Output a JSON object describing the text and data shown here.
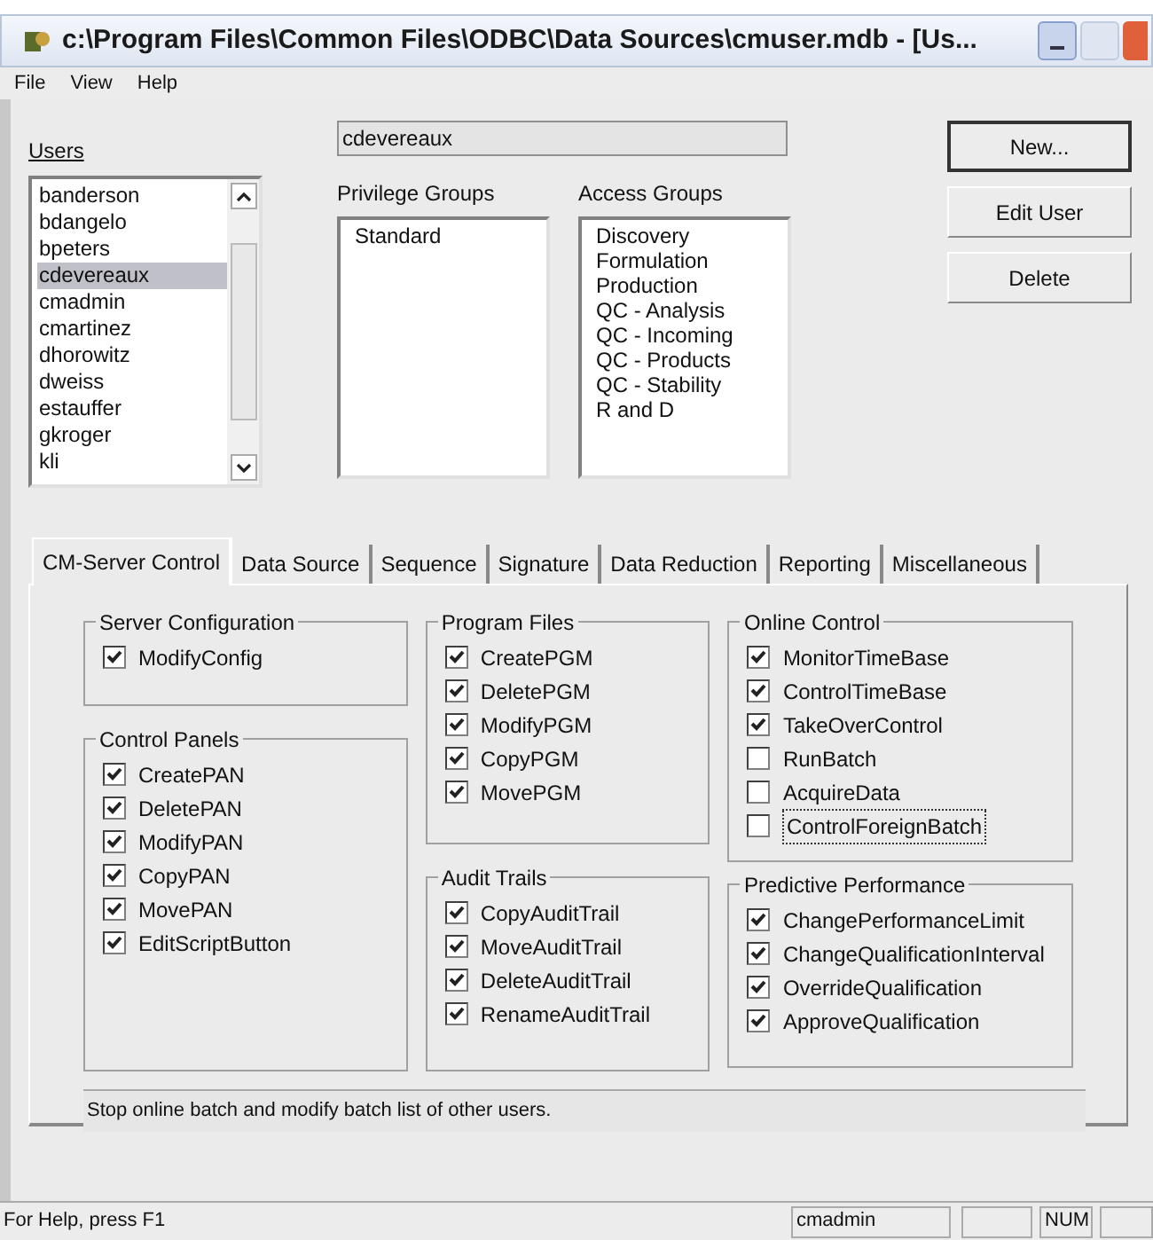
{
  "window": {
    "title": "c:\\Program Files\\Common Files\\ODBC\\Data Sources\\cmuser.mdb - [Us..."
  },
  "menu": [
    "File",
    "View",
    "Help"
  ],
  "users": {
    "label": "Users",
    "items": [
      {
        "name": "banderson",
        "selected": false
      },
      {
        "name": "bdangelo",
        "selected": false
      },
      {
        "name": "bpeters",
        "selected": false
      },
      {
        "name": "cdevereaux",
        "selected": true
      },
      {
        "name": "cmadmin",
        "selected": false
      },
      {
        "name": "cmartinez",
        "selected": false
      },
      {
        "name": "dhorowitz",
        "selected": false
      },
      {
        "name": "dweiss",
        "selected": false
      },
      {
        "name": "estauffer",
        "selected": false
      },
      {
        "name": "gkroger",
        "selected": false
      },
      {
        "name": "kli",
        "selected": false
      }
    ]
  },
  "user_name": {
    "value": "cdevereaux"
  },
  "privilege_groups": {
    "label": "Privilege Groups",
    "items": [
      "Standard"
    ]
  },
  "access_groups": {
    "label": "Access Groups",
    "items": [
      "Discovery",
      "Formulation",
      "Production",
      "QC - Analysis",
      "QC - Incoming",
      "QC - Products",
      "QC - Stability",
      "R and D"
    ]
  },
  "buttons": [
    "New...",
    "Edit User",
    "Delete"
  ],
  "tabs": [
    {
      "label": "CM-Server Control",
      "selected": true
    },
    {
      "label": "Data Source",
      "selected": false
    },
    {
      "label": "Sequence",
      "selected": false
    },
    {
      "label": "Signature",
      "selected": false
    },
    {
      "label": "Data Reduction",
      "selected": false
    },
    {
      "label": "Reporting",
      "selected": false
    },
    {
      "label": "Miscellaneous",
      "selected": false
    }
  ],
  "groups": [
    {
      "title": "Server Configuration",
      "items": [
        {
          "label": "ModifyConfig",
          "checked": true
        }
      ]
    },
    {
      "title": "Control Panels",
      "items": [
        {
          "label": "CreatePAN",
          "checked": true
        },
        {
          "label": "DeletePAN",
          "checked": true
        },
        {
          "label": "ModifyPAN",
          "checked": true
        },
        {
          "label": "CopyPAN",
          "checked": true
        },
        {
          "label": "MovePAN",
          "checked": true
        },
        {
          "label": "EditScriptButton",
          "checked": true
        }
      ]
    },
    {
      "title": "Program Files",
      "items": [
        {
          "label": "CreatePGM",
          "checked": true
        },
        {
          "label": "DeletePGM",
          "checked": true
        },
        {
          "label": "ModifyPGM",
          "checked": true
        },
        {
          "label": "CopyPGM",
          "checked": true
        },
        {
          "label": "MovePGM",
          "checked": true
        }
      ]
    },
    {
      "title": "Audit Trails",
      "items": [
        {
          "label": "CopyAuditTrail",
          "checked": true
        },
        {
          "label": "MoveAuditTrail",
          "checked": true
        },
        {
          "label": "DeleteAuditTrail",
          "checked": true
        },
        {
          "label": "RenameAuditTrail",
          "checked": true
        }
      ]
    },
    {
      "title": "Online Control",
      "items": [
        {
          "label": "MonitorTimeBase",
          "checked": true
        },
        {
          "label": "ControlTimeBase",
          "checked": true
        },
        {
          "label": "TakeOverControl",
          "checked": true
        },
        {
          "label": "RunBatch",
          "checked": false
        },
        {
          "label": "AcquireData",
          "checked": false
        },
        {
          "label": "ControlForeignBatch",
          "checked": false
        }
      ]
    },
    {
      "title": "Predictive Performance",
      "items": [
        {
          "label": "ChangePerformanceLimit",
          "checked": true
        },
        {
          "label": "ChangeQualificationInterval",
          "checked": true
        },
        {
          "label": "OverrideQualification",
          "checked": true
        },
        {
          "label": "ApproveQualification",
          "checked": true
        }
      ]
    }
  ],
  "description": "Stop online batch and modify batch list of other users.",
  "status_bar": {
    "help": "For Help, press F1",
    "user": "cmadmin",
    "num": "NUM"
  }
}
